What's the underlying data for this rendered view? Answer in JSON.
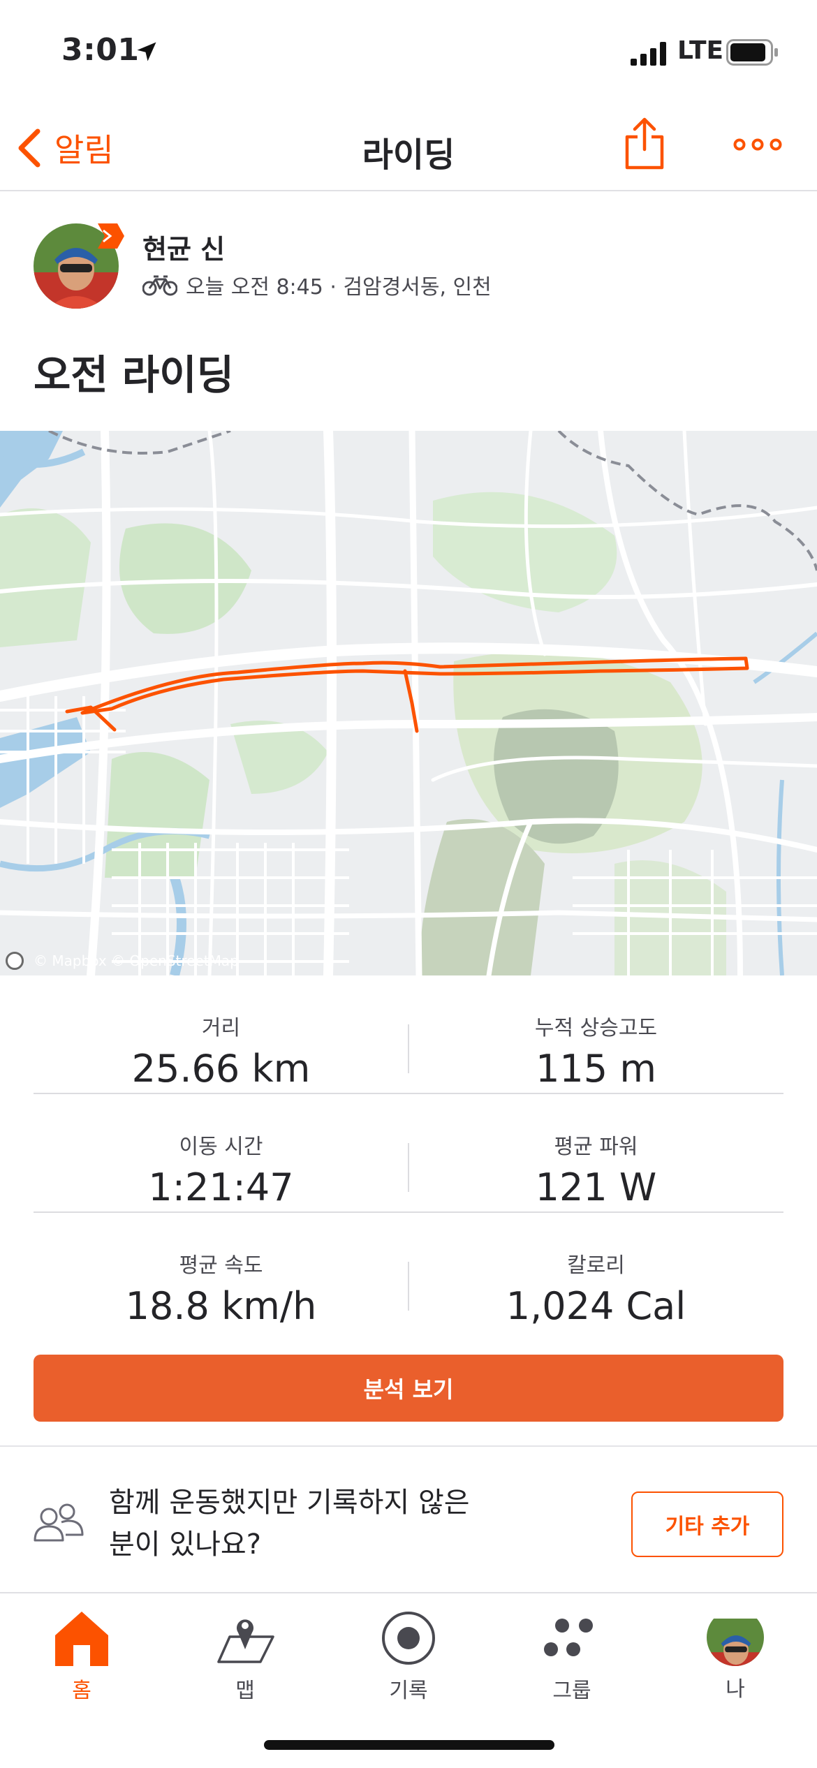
{
  "status_bar": {
    "time": "3:01",
    "network": "LTE"
  },
  "nav": {
    "back_label": "알림",
    "title": "라이딩"
  },
  "athlete": {
    "name": "현균 신",
    "meta": "오늘 오전 8:45 · 검암경서동, 인천"
  },
  "activity": {
    "title": "오전 라이딩"
  },
  "map": {
    "attribution": "© Mapbox © OpenStreetMap",
    "route_color": "#fc5200"
  },
  "stats": {
    "distance_label": "거리",
    "distance_value": "25.66 km",
    "elevation_label": "누적 상승고도",
    "elevation_value": "115 m",
    "moving_time_label": "이동 시간",
    "moving_time_value": "1:21:47",
    "power_label": "평균 파워",
    "power_value": "121 W",
    "speed_label": "평균 속도",
    "speed_value": "18.8 km/h",
    "calories_label": "칼로리",
    "calories_value": "1,024 Cal"
  },
  "analyze_button": "분석 보기",
  "add_others": {
    "text_line1": "함께 운동했지만 기록하지 않은",
    "text_line2": "분이 있나요?",
    "button": "기타 추가"
  },
  "tabs": [
    {
      "label": "홈",
      "icon": "home-icon",
      "active": true
    },
    {
      "label": "맵",
      "icon": "map-pin-icon",
      "active": false
    },
    {
      "label": "기록",
      "icon": "record-icon",
      "active": false
    },
    {
      "label": "그룹",
      "icon": "groups-icon",
      "active": false
    },
    {
      "label": "나",
      "icon": "profile-avatar",
      "active": false
    }
  ],
  "colors": {
    "accent": "#fc5200",
    "button_bg": "#ea5f2c",
    "text": "#242428"
  }
}
